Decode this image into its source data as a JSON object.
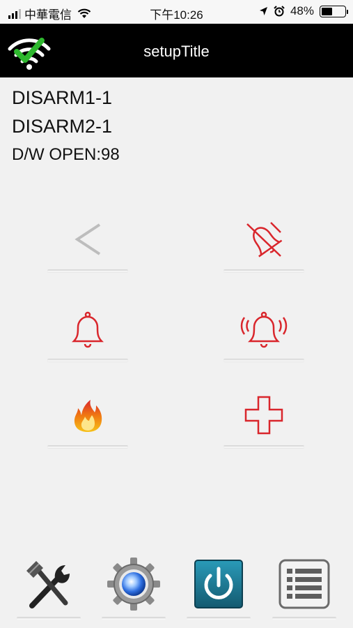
{
  "status_bar": {
    "carrier": "中華電信",
    "time": "下午10:26",
    "battery_percent": "48%",
    "battery_level": 0.48,
    "icons": [
      "signal-icon",
      "wifi-icon",
      "location-arrow-icon",
      "alarm-clock-icon",
      "battery-icon"
    ]
  },
  "nav": {
    "title": "setupTitle",
    "logo_icon": "wifi-check-icon"
  },
  "status_lines": {
    "line1": "DISARM1-1",
    "line2": "DISARM2-1",
    "line3": "D/W OPEN:98"
  },
  "buttons": [
    {
      "name": "back-button",
      "icon": "chevron-left-icon"
    },
    {
      "name": "silence-button",
      "icon": "bell-slash-icon"
    },
    {
      "name": "alarm-button",
      "icon": "bell-icon"
    },
    {
      "name": "panic-alarm-button",
      "icon": "bell-ringing-icon"
    },
    {
      "name": "fire-button",
      "icon": "fire-icon"
    },
    {
      "name": "medical-button",
      "icon": "medical-cross-icon"
    }
  ],
  "toolbar": [
    {
      "name": "tools-button",
      "icon": "hammer-wrench-icon"
    },
    {
      "name": "settings-button",
      "icon": "gear-icon"
    },
    {
      "name": "power-button",
      "icon": "power-icon"
    },
    {
      "name": "list-button",
      "icon": "list-icon"
    }
  ],
  "colors": {
    "nav_background": "#000000",
    "page_background": "#f1f1f1",
    "alert_red": "#d9262c",
    "logo_green": "#2eb82e",
    "power_teal": "#1d7a95"
  }
}
